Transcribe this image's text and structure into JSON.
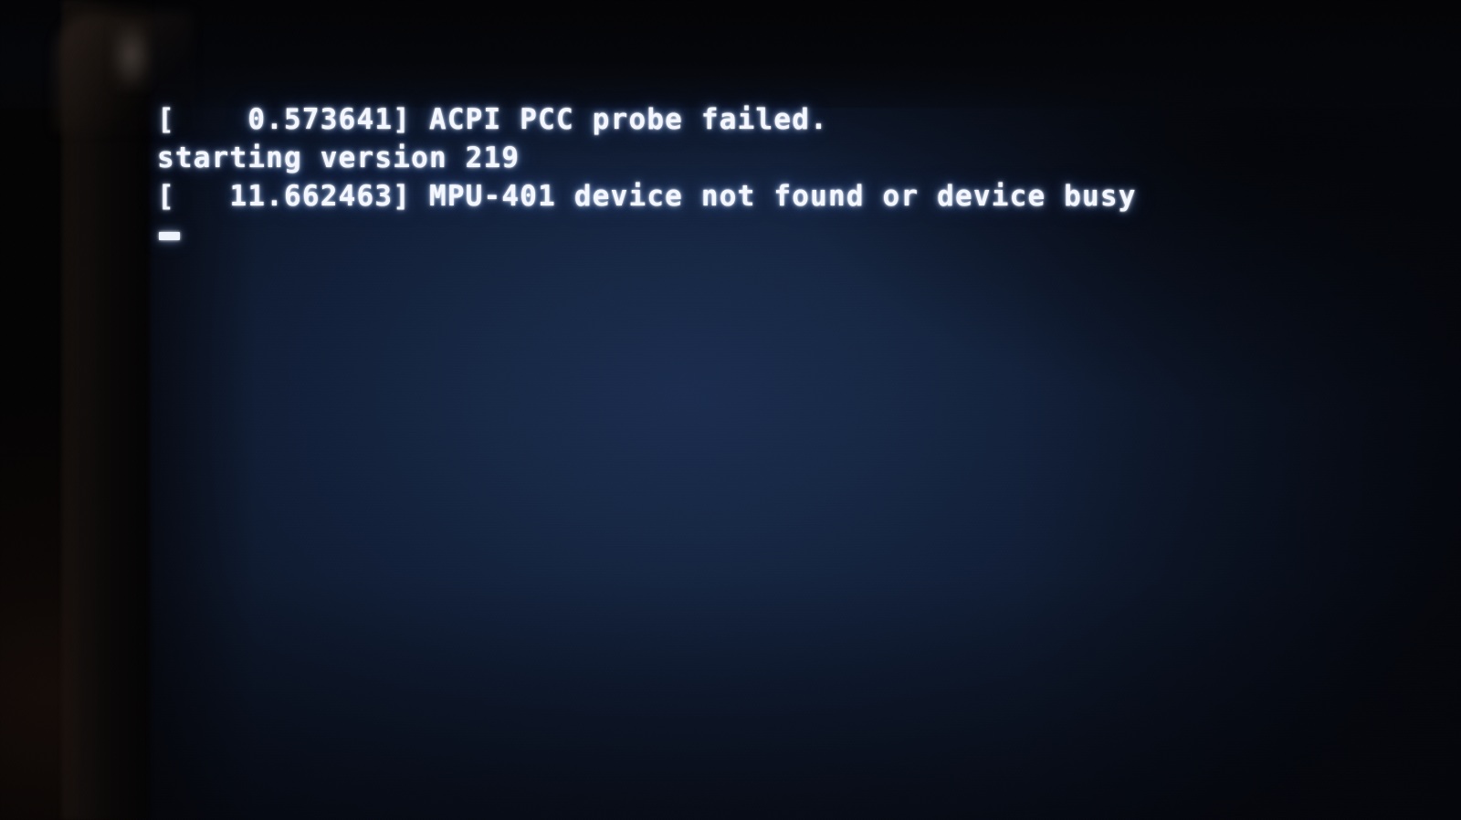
{
  "screen": {
    "kind": "linux-boot-console",
    "background_color": "#16274a",
    "text_color": "#f4f7ff",
    "bezel_color": "#0a0706",
    "room_color": "#0a0605"
  },
  "console": {
    "lines": [
      {
        "text": "[    0.573641] ACPI PCC probe failed."
      },
      {
        "text": "starting version 219"
      },
      {
        "text": "[   11.662463] MPU-401 device not found or device busy"
      }
    ],
    "cursor": {
      "style": "underscore-block",
      "visible": true,
      "row": 4,
      "column": 1
    }
  }
}
